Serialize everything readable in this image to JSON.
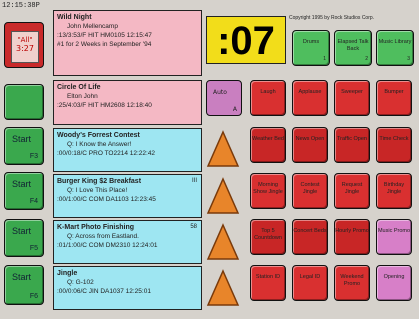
{
  "clock": "12:15:38P",
  "timer": ":07",
  "copyright": "Copyright 1995 by Rock Studios Corp.",
  "all_button": {
    "label": "\"All\"",
    "time": "3:27"
  },
  "left_buttons": [
    {
      "label": "",
      "sub": ""
    },
    {
      "label": "Start",
      "sub": "F3"
    },
    {
      "label": "Start",
      "sub": "F4"
    },
    {
      "label": "Start",
      "sub": "F5"
    },
    {
      "label": "Start",
      "sub": "F6"
    }
  ],
  "carts": [
    {
      "title": "Wild Night",
      "line1": "John Mellencamp",
      "line2": ":13/3:53/F  HIT HM0105 12:15:47",
      "line3": "#1 for 2 Weeks in September '94",
      "index": ""
    },
    {
      "title": "Circle Of Life",
      "line1": "Elton John",
      "line2": ":25/4:03/F  HIT HM2608 12:18:40",
      "line3": "",
      "index": ""
    },
    {
      "title": "Woody's Forrest Contest",
      "line1": "Q: I Know the Answer!",
      "line2": ":00/0:18/C  PRO TO2214 12:22:42",
      "line3": "",
      "index": ""
    },
    {
      "title": "Burger King $2 Breakfast",
      "line1": "Q: I Love This Place!",
      "line2": ":00/1:00/C  COM DA1103 12:23:45",
      "line3": "",
      "index": "III"
    },
    {
      "title": "K-Mart Photo Finishing",
      "line1": "Q: Across from Eastland.",
      "line2": ":01/1:00/C  COM DM2310 12:24:01",
      "line3": "",
      "index": "58"
    },
    {
      "title": "Jingle",
      "line1": "Q: G-102",
      "line2": ":00/0:06/C  JIN DA1037 12:25:01",
      "line3": "",
      "index": ""
    }
  ],
  "auto": {
    "label": "Auto",
    "key": "A"
  },
  "top_buttons": [
    {
      "label": "Drums",
      "key": "1"
    },
    {
      "label": "Elapsed Talk Back",
      "key": "2"
    },
    {
      "label": "Music Library",
      "key": "3"
    }
  ],
  "grid_buttons": [
    {
      "label": "Laugh",
      "key": ""
    },
    {
      "label": "Applause",
      "key": ""
    },
    {
      "label": "Sweeper",
      "key": ""
    },
    {
      "label": "Bumper",
      "key": ""
    },
    {
      "label": "Weather Bed",
      "key": ""
    },
    {
      "label": "News Open",
      "key": ""
    },
    {
      "label": "Traffic Open",
      "key": ""
    },
    {
      "label": "Time Check",
      "key": ""
    },
    {
      "label": "Morning Show Jingle",
      "key": ""
    },
    {
      "label": "Contest Jingle",
      "key": ""
    },
    {
      "label": "Request Jingle",
      "key": ""
    },
    {
      "label": "Birthday Jingle",
      "key": ""
    },
    {
      "label": "Top 5 Countdown",
      "key": ""
    },
    {
      "label": "Concert Beds",
      "key": ""
    },
    {
      "label": "Hourly Promo",
      "key": ""
    },
    {
      "label": "Music Promo",
      "key": ""
    },
    {
      "label": "Station ID",
      "key": ""
    },
    {
      "label": "Legal ID",
      "key": ""
    },
    {
      "label": "Weekend Promo",
      "key": ""
    },
    {
      "label": "Opening",
      "key": ""
    }
  ]
}
